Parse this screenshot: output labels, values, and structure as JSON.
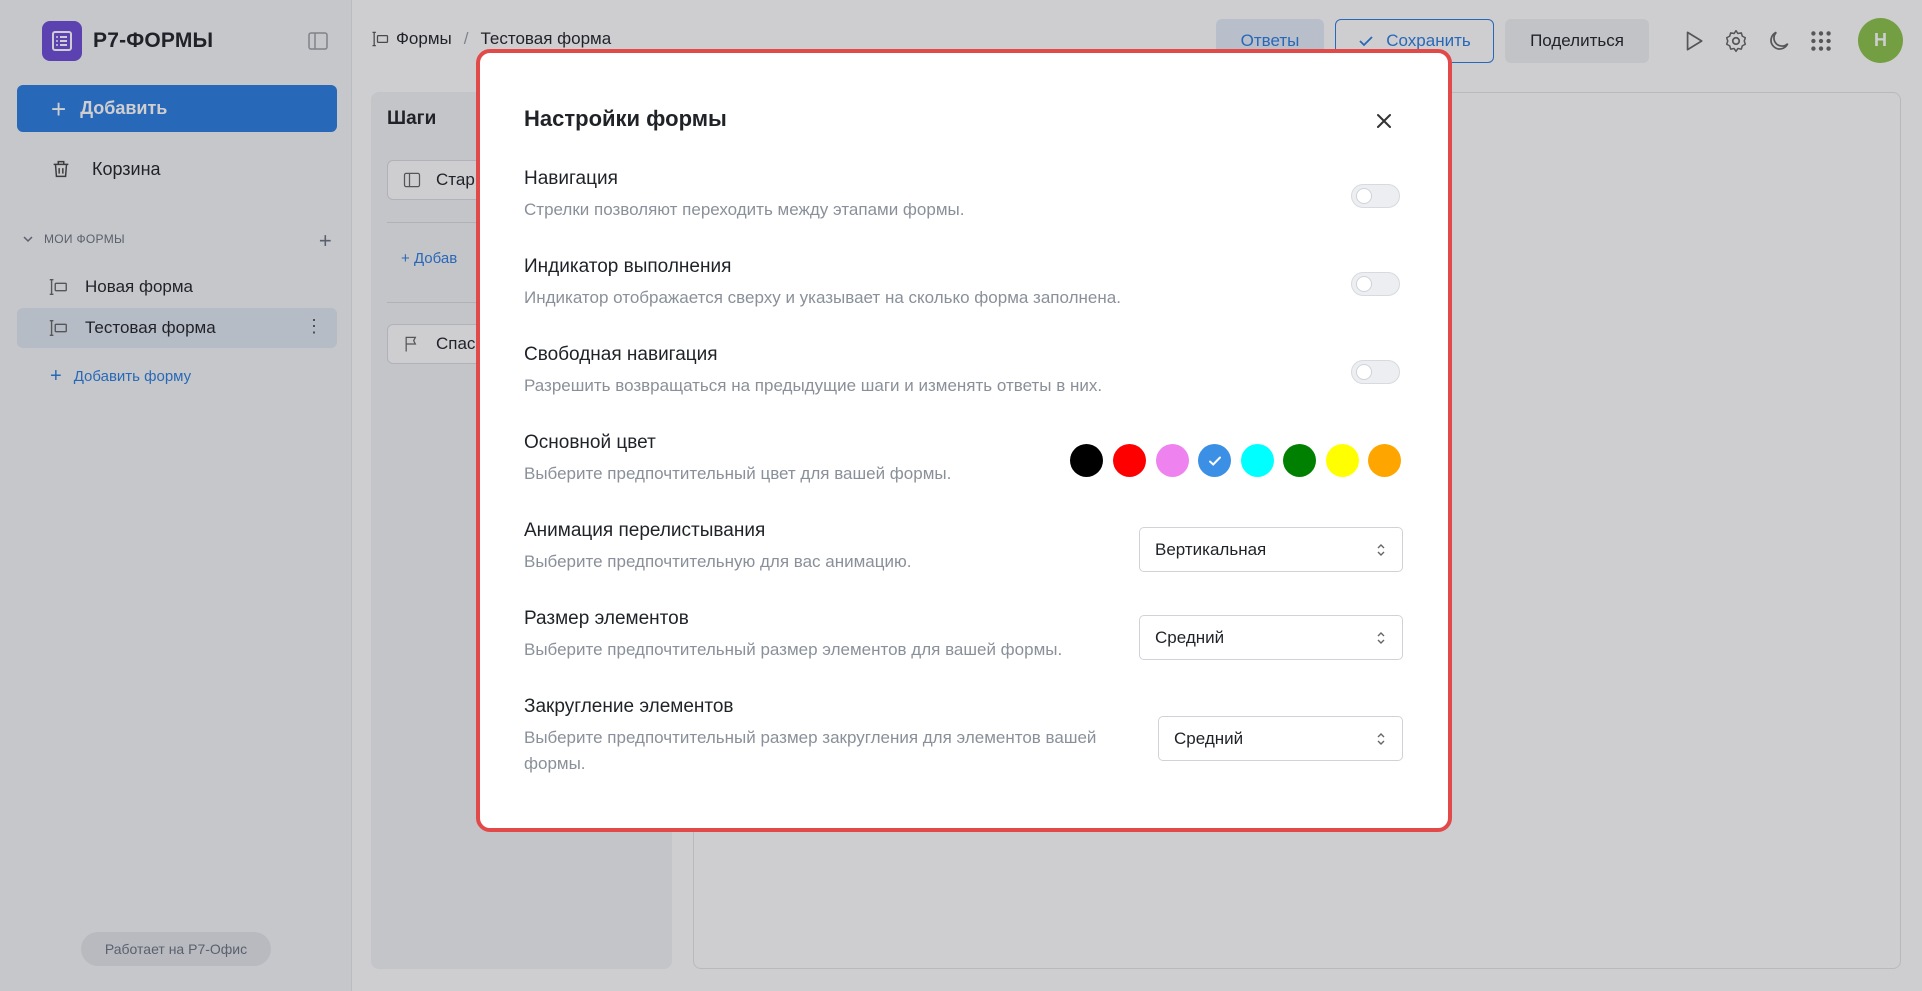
{
  "app": {
    "brand": "Р7-ФОРМЫ",
    "powered_by": "Работает на Р7-Офис"
  },
  "sidebar": {
    "add_label": "Добавить",
    "trash_label": "Корзина",
    "section_title": "МОИ ФОРМЫ",
    "forms": [
      {
        "label": "Новая форма",
        "active": false
      },
      {
        "label": "Тестовая форма",
        "active": true
      }
    ],
    "add_form_label": "Добавить форму"
  },
  "header": {
    "breadcrumbs": [
      "Формы",
      "Тестовая форма"
    ],
    "answers_label": "Ответы",
    "save_label": "Сохранить",
    "share_label": "Поделиться",
    "avatar_initial": "Н"
  },
  "steps": {
    "title": "Шаги",
    "start_label": "Стар",
    "add_label": "Добав",
    "thanks_label": "Спас"
  },
  "modal": {
    "title": "Настройки формы",
    "navigation": {
      "title": "Навигация",
      "desc": "Стрелки позволяют переходить между этапами формы.",
      "enabled": false
    },
    "progress": {
      "title": "Индикатор выполнения",
      "desc": "Индикатор отображается сверху и указывает на сколько форма заполнена.",
      "enabled": false
    },
    "free_nav": {
      "title": "Свободная навигация",
      "desc": "Разрешить возвращаться на предыдущие шаги и изменять ответы в них.",
      "enabled": false
    },
    "main_color": {
      "title": "Основной цвет",
      "desc": "Выберите предпочтительный цвет для вашей формы.",
      "options": [
        "#000000",
        "#ff0000",
        "#ee82ee",
        "#3b8fe4",
        "#00ffff",
        "#008000",
        "#ffff00",
        "#ffa500"
      ],
      "selected": "#3b8fe4"
    },
    "animation": {
      "title": "Анимация перелистывания",
      "desc": "Выберите предпочтительную для вас анимацию.",
      "value": "Вертикальная"
    },
    "size": {
      "title": "Размер элементов",
      "desc": "Выберите предпочтительный размер элементов для вашей формы.",
      "value": "Средний"
    },
    "rounding": {
      "title": "Закругление элементов",
      "desc": "Выберите предпочтительный размер закругления для элементов вашей формы.",
      "value": "Средний"
    }
  }
}
